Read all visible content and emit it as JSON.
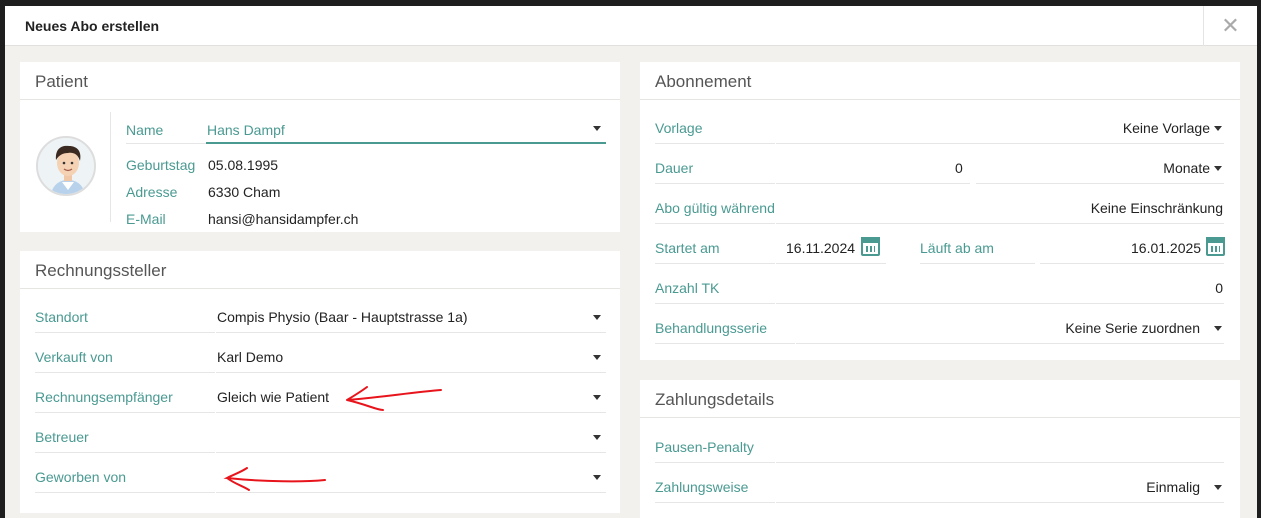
{
  "modal": {
    "title": "Neues Abo erstellen",
    "close_glyph": "✕"
  },
  "patient": {
    "heading": "Patient",
    "name_label": "Name",
    "name_value": "Hans Dampf",
    "birth_label": "Geburtstag",
    "birth_value": "05.08.1995",
    "address_label": "Adresse",
    "address_value": "6330 Cham",
    "email_label": "E-Mail",
    "email_value": "hansi@hansidampfer.ch"
  },
  "biller": {
    "heading": "Rechnungssteller",
    "location_label": "Standort",
    "location_value": "Compis Physio (Baar - Hauptstrasse 1a)",
    "seller_label": "Verkauft von",
    "seller_value": "Karl Demo",
    "recipient_label": "Rechnungsempfänger",
    "recipient_value": "Gleich wie Patient",
    "supervisor_label": "Betreuer",
    "supervisor_value": "",
    "recruiter_label": "Geworben von",
    "recruiter_value": ""
  },
  "subscription": {
    "heading": "Abonnement",
    "template_label": "Vorlage",
    "template_value": "Keine Vorlage",
    "duration_label": "Dauer",
    "duration_value": "0",
    "duration_unit": "Monate",
    "validity_label": "Abo gültig während",
    "validity_value": "Keine Einschränkung",
    "start_label": "Startet am",
    "start_value": "16.11.2024",
    "expires_label": "Läuft ab am",
    "expires_value": "16.01.2025",
    "tk_label": "Anzahl TK",
    "tk_value": "0",
    "series_label": "Behandlungsserie",
    "series_value": "Keine Serie zuordnen"
  },
  "payment": {
    "heading": "Zahlungsdetails",
    "penalty_label": "Pausen-Penalty",
    "penalty_value": "",
    "method_label": "Zahlungsweise",
    "method_value": "Einmalig"
  },
  "colors": {
    "accent": "#4a9a92",
    "annotation": "#e8141c",
    "background": "#f3f1ee"
  }
}
